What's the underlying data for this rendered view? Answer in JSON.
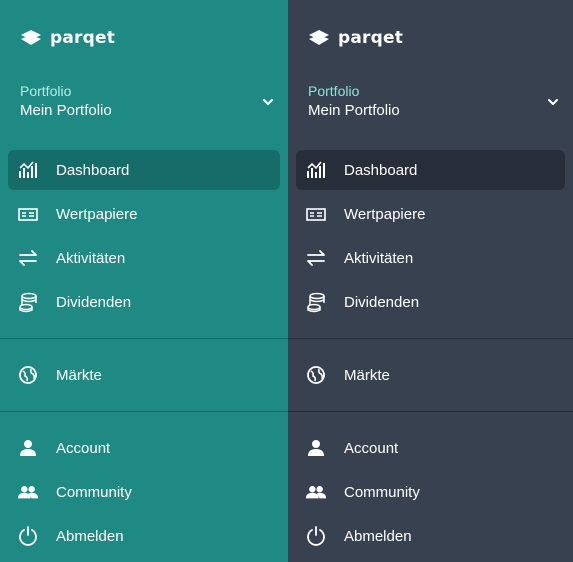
{
  "brand": {
    "name": "parqet"
  },
  "colors": {
    "teal_bg": "#1f8a84",
    "slate_bg": "#384150",
    "accent": "#8fe3d8"
  },
  "portfolio": {
    "label": "Portfolio",
    "value": "Mein Portfolio"
  },
  "nav": {
    "dashboard": {
      "label": "Dashboard",
      "icon": "chart-bars-icon"
    },
    "securities": {
      "label": "Wertpapiere",
      "icon": "ticket-icon"
    },
    "activities": {
      "label": "Aktivitäten",
      "icon": "arrows-exchange-icon"
    },
    "dividends": {
      "label": "Dividenden",
      "icon": "coins-icon"
    },
    "markets": {
      "label": "Märkte",
      "icon": "globe-icon"
    },
    "account": {
      "label": "Account",
      "icon": "user-icon"
    },
    "community": {
      "label": "Community",
      "icon": "users-icon"
    },
    "logout": {
      "label": "Abmelden",
      "icon": "power-icon"
    }
  }
}
